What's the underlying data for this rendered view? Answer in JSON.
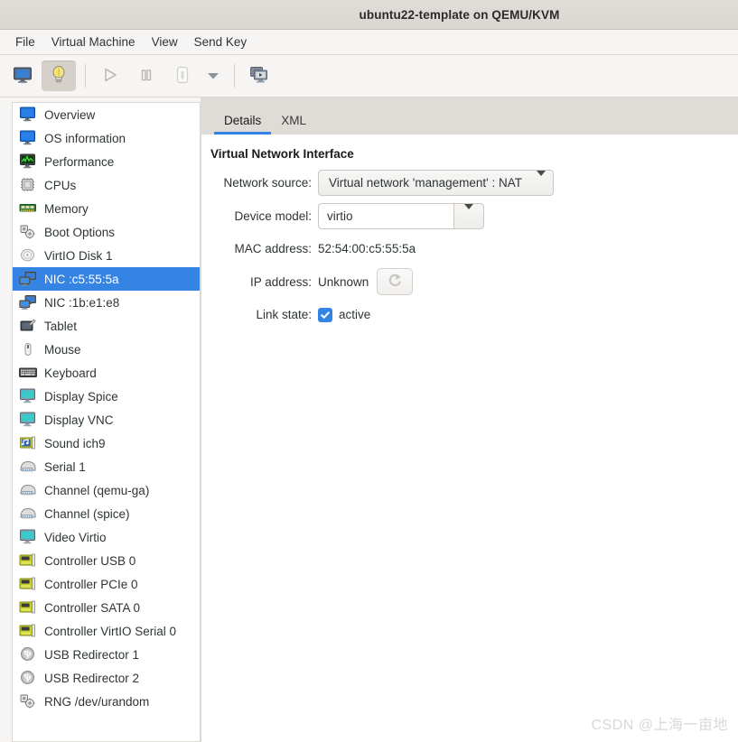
{
  "window": {
    "title": "ubuntu22-template on QEMU/KVM"
  },
  "menubar": {
    "items": [
      {
        "label": "File",
        "name": "menu-file"
      },
      {
        "label": "Virtual Machine",
        "name": "menu-virtual-machine"
      },
      {
        "label": "View",
        "name": "menu-view"
      },
      {
        "label": "Send Key",
        "name": "menu-send-key"
      }
    ]
  },
  "toolbar": {
    "buttons": [
      {
        "icon": "console-monitor-icon",
        "name": "show-console-button",
        "toggled": false
      },
      {
        "icon": "lightbulb-details-icon",
        "name": "show-details-button",
        "toggled": true
      },
      {
        "icon": "play-icon",
        "name": "run-button",
        "toggled": false
      },
      {
        "icon": "pause-icon",
        "name": "pause-button",
        "toggled": false
      },
      {
        "icon": "shutdown-icon",
        "name": "shutdown-button",
        "toggled": false
      },
      {
        "icon": "chevron-down-icon",
        "name": "shutdown-menu-button",
        "toggled": false
      },
      {
        "icon": "snapshots-icon",
        "name": "manage-snapshots-button",
        "toggled": false
      }
    ]
  },
  "sidebar": {
    "items": [
      {
        "label": "Overview",
        "icon": "monitor-blue-icon",
        "selected": false
      },
      {
        "label": "OS information",
        "icon": "monitor-blue-icon",
        "selected": false
      },
      {
        "label": "Performance",
        "icon": "performance-graph-icon",
        "selected": false
      },
      {
        "label": "CPUs",
        "icon": "cpu-chip-icon",
        "selected": false
      },
      {
        "label": "Memory",
        "icon": "memory-stick-icon",
        "selected": false
      },
      {
        "label": "Boot Options",
        "icon": "gears-icon",
        "selected": false
      },
      {
        "label": "VirtIO Disk 1",
        "icon": "harddisk-icon",
        "selected": false
      },
      {
        "label": "NIC :c5:55:5a",
        "icon": "network-card-icon",
        "selected": true
      },
      {
        "label": "NIC :1b:e1:e8",
        "icon": "network-card-icon",
        "selected": false
      },
      {
        "label": "Tablet",
        "icon": "tablet-icon",
        "selected": false
      },
      {
        "label": "Mouse",
        "icon": "mouse-icon",
        "selected": false
      },
      {
        "label": "Keyboard",
        "icon": "keyboard-icon",
        "selected": false
      },
      {
        "label": "Display Spice",
        "icon": "display-screen-icon",
        "selected": false
      },
      {
        "label": "Display VNC",
        "icon": "display-screen-icon",
        "selected": false
      },
      {
        "label": "Sound ich9",
        "icon": "sound-card-icon",
        "selected": false
      },
      {
        "label": "Serial 1",
        "icon": "serial-port-icon",
        "selected": false
      },
      {
        "label": "Channel (qemu-ga)",
        "icon": "serial-port-icon",
        "selected": false
      },
      {
        "label": "Channel (spice)",
        "icon": "serial-port-icon",
        "selected": false
      },
      {
        "label": "Video Virtio",
        "icon": "display-screen-icon",
        "selected": false
      },
      {
        "label": "Controller USB 0",
        "icon": "controller-card-icon",
        "selected": false
      },
      {
        "label": "Controller PCIe 0",
        "icon": "controller-card-icon",
        "selected": false
      },
      {
        "label": "Controller SATA 0",
        "icon": "controller-card-icon",
        "selected": false
      },
      {
        "label": "Controller VirtIO Serial 0",
        "icon": "controller-card-icon",
        "selected": false
      },
      {
        "label": "USB Redirector 1",
        "icon": "usb-icon",
        "selected": false
      },
      {
        "label": "USB Redirector 2",
        "icon": "usb-icon",
        "selected": false
      },
      {
        "label": "RNG /dev/urandom",
        "icon": "gears-icon",
        "selected": false
      }
    ]
  },
  "detail": {
    "tabs": [
      {
        "label": "Details",
        "active": true
      },
      {
        "label": "XML",
        "active": false
      }
    ],
    "section_title": "Virtual Network Interface",
    "fields": {
      "network_source": {
        "label": "Network source:",
        "value": "Virtual network 'management' : NAT"
      },
      "device_model": {
        "label": "Device model:",
        "value": "virtio"
      },
      "mac_address": {
        "label": "MAC address:",
        "value": "52:54:00:c5:55:5a"
      },
      "ip_address": {
        "label": "IP address:",
        "value": "Unknown",
        "refresh_icon": "refresh-icon"
      },
      "link_state": {
        "label": "Link state:",
        "value": "active",
        "checked": true
      }
    }
  },
  "watermark": {
    "text": "CSDN @上海一亩地"
  },
  "colors": {
    "selection": "#3584e4",
    "tab_underline": "#3584e4",
    "titlebar": "#dedbd6",
    "panel_bg": "#f6f5f4"
  }
}
